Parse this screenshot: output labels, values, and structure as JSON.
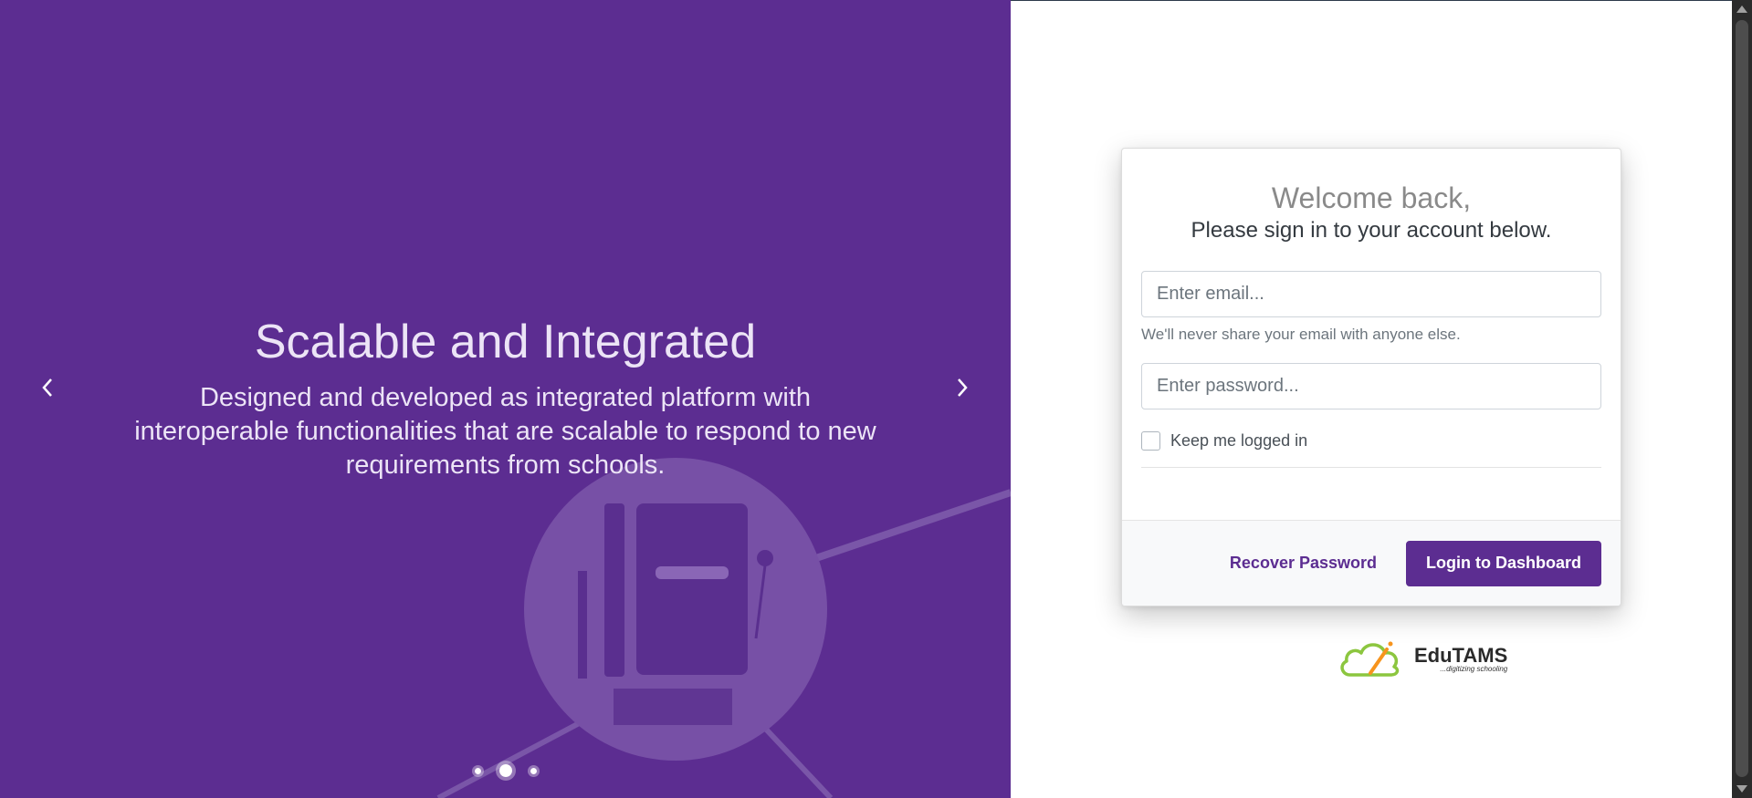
{
  "carousel": {
    "title": "Scalable and Integrated",
    "text": "Designed and developed as integrated platform with interoperable functionalities that are scalable to respond to new requirements from schools.",
    "prev_icon": "chevron-left-icon",
    "next_icon": "chevron-right-icon",
    "indicators": [
      {
        "active": false
      },
      {
        "active": true
      },
      {
        "active": false
      }
    ],
    "background_color": "#5c2d91"
  },
  "login": {
    "welcome": "Welcome back,",
    "subtitle": "Please sign in to your account below.",
    "email_placeholder": "Enter email...",
    "email_help": "We'll never share your email with anyone else.",
    "password_placeholder": "Enter password...",
    "remember_label": "Keep me logged in",
    "recover_label": "Recover Password",
    "login_label": "Login to Dashboard"
  },
  "brand": {
    "name": "EduTAMS",
    "tagline": "...digitizing schooling",
    "logo_icon": "cloud-pencil-logo-icon"
  },
  "colors": {
    "accent": "#5c2d91",
    "logo_green": "#8cc63f",
    "logo_orange": "#f7941d"
  }
}
